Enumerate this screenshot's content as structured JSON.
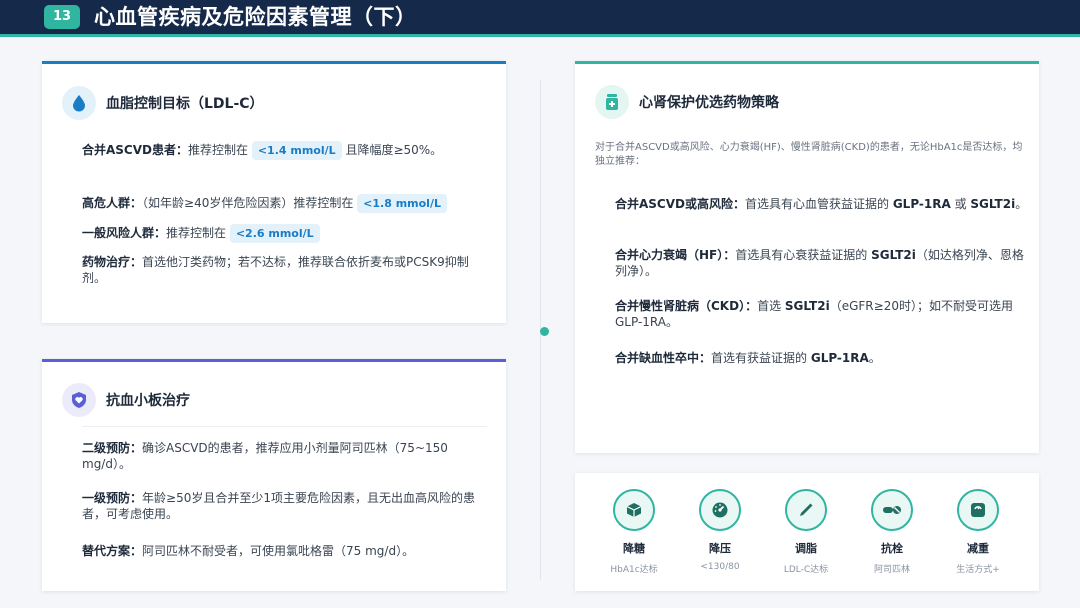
{
  "header": {
    "slide_number": "13",
    "title": "心血管疾病及危险因素管理（下）"
  },
  "lipid": {
    "title": "血脂控制目标（LDL-C）",
    "color": "#1a7cc4",
    "ascvd": {
      "label": "合并ASCVD患者：",
      "pre": "推荐控制在 ",
      "value": "<1.4 mmol/L",
      "post": " 且降幅度≥50%。"
    },
    "high": {
      "label": "高危人群：",
      "pre": "（如年龄≥40岁伴危险因素）推荐控制在 ",
      "value": "<1.8 mmol/L"
    },
    "general": {
      "label": "一般风险人群：",
      "pre": "推荐控制在 ",
      "value": "<2.6 mmol/L"
    },
    "drug": {
      "label": "药物治疗：",
      "text": "首选他汀类药物；若不达标，推荐联合依折麦布或PCSK9抑制剂。"
    }
  },
  "antiplatelet": {
    "title": "抗血小板治疗",
    "color": "#5b5fd6",
    "secondary": {
      "label": "二级预防：",
      "text": "确诊ASCVD的患者，推荐应用小剂量阿司匹林（75~150 mg/d）。"
    },
    "primary": {
      "label": "一级预防：",
      "text": "年龄≥50岁且合并至少1项主要危险因素，且无出血高风险的患者，可考虑使用。"
    },
    "alternative": {
      "label": "替代方案：",
      "text": "阿司匹林不耐受者，可使用氯吡格雷（75 mg/d）。"
    }
  },
  "cardiorenal": {
    "title": "心肾保护优选药物策略",
    "color": "#2fb5a0",
    "intro": "对于合并ASCVD或高风险、心力衰竭(HF)、慢性肾脏病(CKD)的患者，无论HbA1c是否达标，均独立推荐：",
    "recs": [
      {
        "label": "合并ASCVD或高风险：",
        "pre": "首选具有心血管获益证据的 ",
        "drug1": "GLP-1RA",
        "mid": " 或 ",
        "drug2": "SGLT2i",
        "post": "。"
      },
      {
        "label": "合并心力衰竭（HF）：",
        "pre": "首选具有心衰获益证据的 ",
        "drug1": "SGLT2i",
        "post": "（如达格列净、恩格列净）。"
      },
      {
        "label": "合并慢性肾脏病（CKD）：",
        "pre": "首选 ",
        "drug1": "SGLT2i",
        "post": "（eGFR≥20时）；如不耐受可选用GLP-1RA。"
      },
      {
        "label": "合并缺血性卒中：",
        "pre": "首选有获益证据的 ",
        "drug1": "GLP-1RA",
        "post": "。"
      }
    ]
  },
  "goals": [
    {
      "label": "降糖",
      "sub": "HbA1c达标",
      "icon": "cube-icon"
    },
    {
      "label": "降压",
      "sub": "<130/80",
      "icon": "gauge-icon"
    },
    {
      "label": "调脂",
      "sub": "LDL-C达标",
      "icon": "pen-icon"
    },
    {
      "label": "抗栓",
      "sub": "阿司匹林",
      "icon": "pill-icon"
    },
    {
      "label": "减重",
      "sub": "生活方式+",
      "icon": "scale-icon"
    }
  ]
}
